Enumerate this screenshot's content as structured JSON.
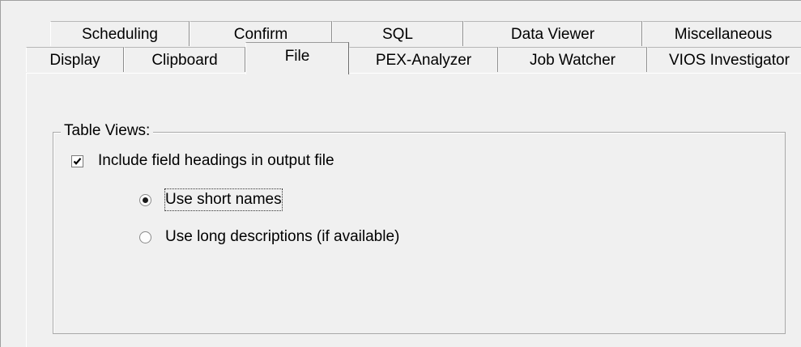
{
  "tabs": {
    "back_row": [
      "Scheduling",
      "Confirm",
      "SQL",
      "Data Viewer",
      "Miscellaneous"
    ],
    "front_row": [
      "Display",
      "Clipboard",
      "File",
      "PEX-Analyzer",
      "Job Watcher",
      "VIOS Investigator"
    ],
    "selected": "File"
  },
  "group": {
    "title": "Table Views:"
  },
  "include_headings": {
    "label": "Include field headings in output file",
    "checked": true
  },
  "heading_style": {
    "options": [
      "Use short names",
      "Use long descriptions (if available)"
    ],
    "selected": "Use short names"
  }
}
